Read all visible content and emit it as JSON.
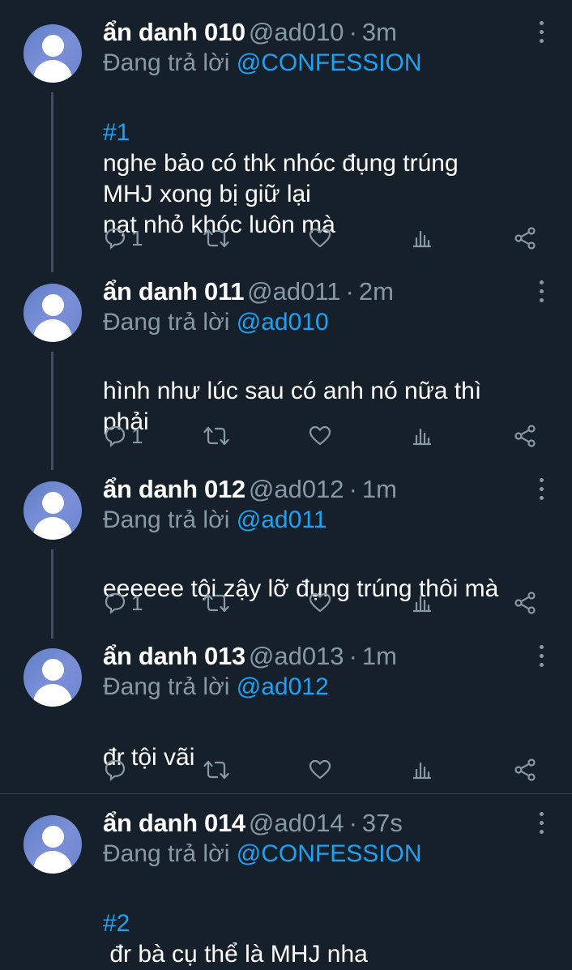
{
  "tweets": [
    {
      "name": "ẩn danh 010",
      "handle": "@ad010",
      "time": "3m",
      "reply_prefix": "Đang trả lời",
      "reply_to": "@CONFESSION",
      "tag": "#1",
      "text": "nghe bảo có thk nhóc đụng trúng\nMHJ xong bị giữ lại\nnạt nhỏ khóc luôn mà",
      "reply_count": "1"
    },
    {
      "name": "ẩn danh 011",
      "handle": "@ad011",
      "time": "2m",
      "reply_prefix": "Đang trả lời",
      "reply_to": "@ad010",
      "tag": "",
      "text": "hình như lúc sau có anh nó nữa thì\nphải",
      "reply_count": "1"
    },
    {
      "name": "ẩn danh 012",
      "handle": "@ad012",
      "time": "1m",
      "reply_prefix": "Đang trả lời",
      "reply_to": "@ad011",
      "tag": "",
      "text": "eeeeee tội zậy lỡ đụng trúng thôi mà",
      "reply_count": "1"
    },
    {
      "name": "ẩn danh 013",
      "handle": "@ad013",
      "time": "1m",
      "reply_prefix": "Đang trả lời",
      "reply_to": "@ad012",
      "tag": "",
      "text": "đr tội vãi",
      "reply_count": ""
    },
    {
      "name": "ẩn danh 014",
      "handle": "@ad014",
      "time": "37s",
      "reply_prefix": "Đang trả lời",
      "reply_to": "@CONFESSION",
      "tag": "#2",
      "text": " đr bà cụ thể là MHJ nha",
      "reply_count": ""
    }
  ],
  "separator_dot": "·",
  "colors": {
    "background": "#15202b",
    "accent": "#1da1f2",
    "muted": "#8899a6",
    "thread_line": "#3d4f61"
  }
}
